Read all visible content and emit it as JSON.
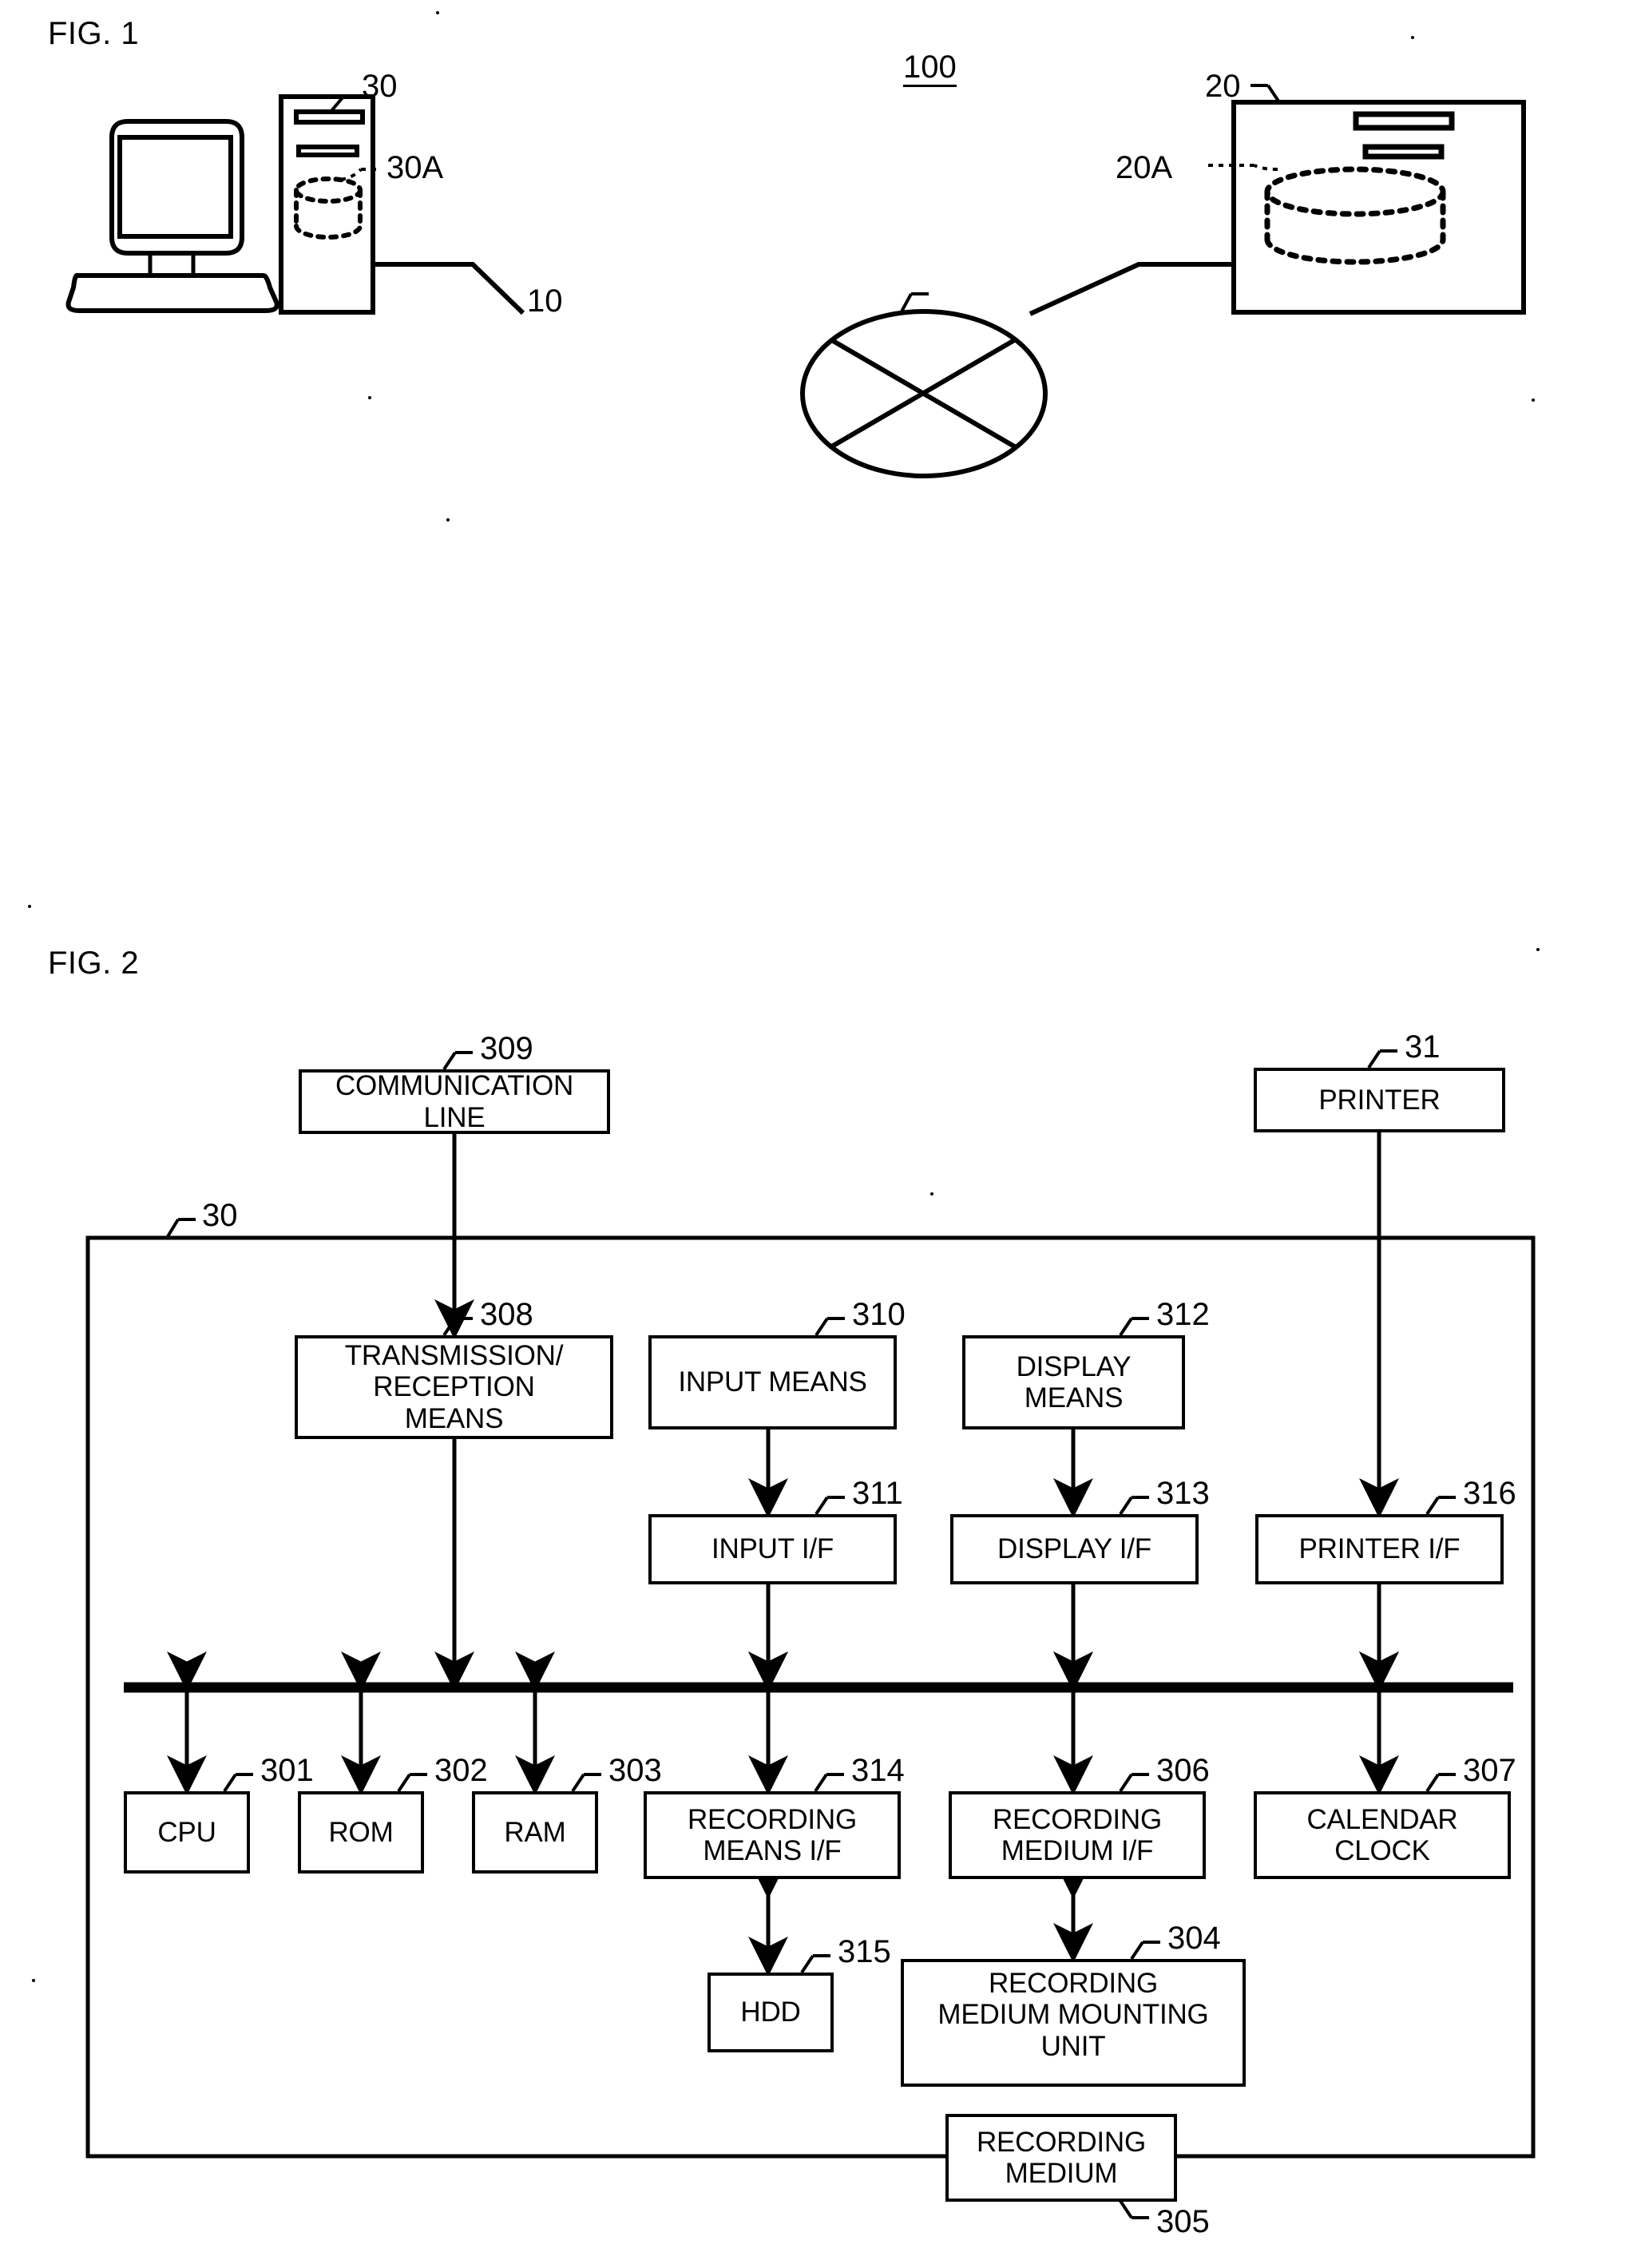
{
  "figures": [
    {
      "id": "fig1",
      "label": "FIG. 1",
      "system_ref": "100",
      "nodes": {
        "workstation_ref": "30",
        "workstation_db_ref": "30A",
        "server_ref": "20",
        "server_db_ref": "20A",
        "network_ref": "10"
      }
    },
    {
      "id": "fig2",
      "label": "FIG. 2",
      "enclosure_ref": "30",
      "blocks": [
        {
          "key": "communication_line",
          "label": "COMMUNICATION LINE",
          "ref": "309"
        },
        {
          "key": "printer",
          "label": "PRINTER",
          "ref": "31"
        },
        {
          "key": "transmission_reception_means",
          "label": "TRANSMISSION/ RECEPTION MEANS",
          "ref": "308"
        },
        {
          "key": "input_means",
          "label": "INPUT MEANS",
          "ref": "310"
        },
        {
          "key": "display_means",
          "label": "DISPLAY MEANS",
          "ref": "312"
        },
        {
          "key": "input_if",
          "label": "INPUT I/F",
          "ref": "311"
        },
        {
          "key": "display_if",
          "label": "DISPLAY I/F",
          "ref": "313"
        },
        {
          "key": "printer_if",
          "label": "PRINTER I/F",
          "ref": "316"
        },
        {
          "key": "cpu",
          "label": "CPU",
          "ref": "301"
        },
        {
          "key": "rom",
          "label": "ROM",
          "ref": "302"
        },
        {
          "key": "ram",
          "label": "RAM",
          "ref": "303"
        },
        {
          "key": "recording_means_if",
          "label": "RECORDING MEANS I/F",
          "ref": "314"
        },
        {
          "key": "recording_medium_if",
          "label": "RECORDING MEDIUM I/F",
          "ref": "306"
        },
        {
          "key": "calendar_clock",
          "label": "CALENDAR CLOCK",
          "ref": "307"
        },
        {
          "key": "hdd",
          "label": "HDD",
          "ref": "315"
        },
        {
          "key": "recording_medium_mounting_unit",
          "label": "RECORDING MEDIUM MOUNTING UNIT",
          "ref": "304"
        },
        {
          "key": "recording_medium",
          "label": "RECORDING MEDIUM",
          "ref": "305"
        }
      ]
    }
  ],
  "fig1": {
    "label": "FIG. 1",
    "system_ref": "100",
    "workstation_ref": "30",
    "workstation_db_ref": "30A",
    "server_ref": "20",
    "server_db_ref": "20A",
    "network_ref": "10"
  },
  "fig2": {
    "label": "FIG. 2",
    "enclosure_ref": "30",
    "communication_line": {
      "label_line1": "COMMUNICATION",
      "label_line2": "LINE",
      "ref": "309"
    },
    "printer": {
      "label": "PRINTER",
      "ref": "31"
    },
    "transmission_reception_means": {
      "label_line1": "TRANSMISSION/",
      "label_line2": "RECEPTION",
      "label_line3": "MEANS",
      "ref": "308"
    },
    "input_means": {
      "label": "INPUT MEANS",
      "ref": "310"
    },
    "display_means": {
      "label_line1": "DISPLAY",
      "label_line2": "MEANS",
      "ref": "312"
    },
    "input_if": {
      "label": "INPUT I/F",
      "ref": "311"
    },
    "display_if": {
      "label": "DISPLAY I/F",
      "ref": "313"
    },
    "printer_if": {
      "label": "PRINTER I/F",
      "ref": "316"
    },
    "cpu": {
      "label": "CPU",
      "ref": "301"
    },
    "rom": {
      "label": "ROM",
      "ref": "302"
    },
    "ram": {
      "label": "RAM",
      "ref": "303"
    },
    "recording_means_if": {
      "label_line1": "RECORDING",
      "label_line2": "MEANS I/F",
      "ref": "314"
    },
    "recording_medium_if": {
      "label_line1": "RECORDING",
      "label_line2": "MEDIUM I/F",
      "ref": "306"
    },
    "calendar_clock": {
      "label_line1": "CALENDAR",
      "label_line2": "CLOCK",
      "ref": "307"
    },
    "hdd": {
      "label": "HDD",
      "ref": "315"
    },
    "recording_medium_mounting_unit": {
      "label_line1": "RECORDING",
      "label_line2": "MEDIUM MOUNTING",
      "label_line3": "UNIT",
      "ref": "304"
    },
    "recording_medium": {
      "label_line1": "RECORDING",
      "label_line2": "MEDIUM",
      "ref": "305"
    }
  },
  "colors": {
    "ink": "#000000",
    "paper": "#ffffff"
  }
}
